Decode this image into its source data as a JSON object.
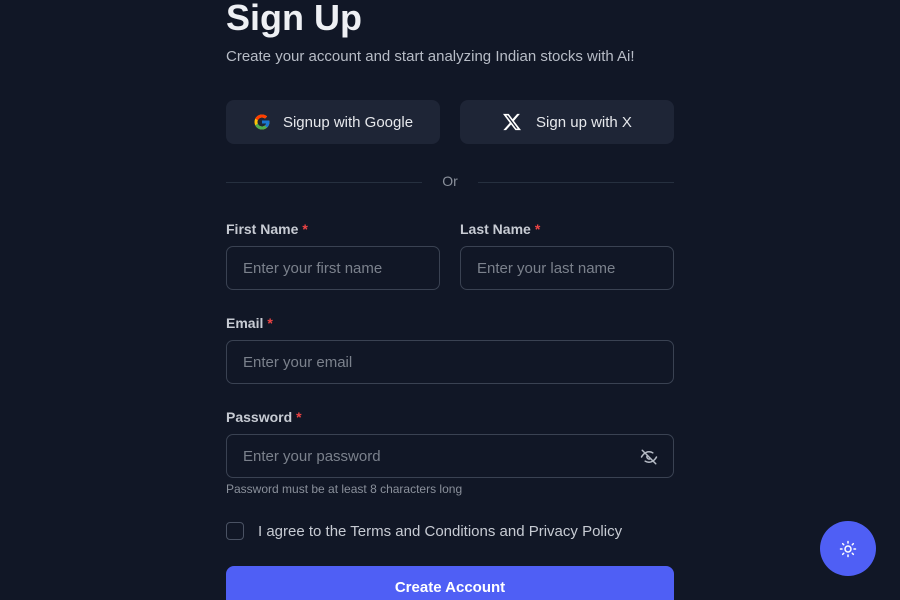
{
  "header": {
    "title": "Sign Up",
    "subtitle": "Create your account and start analyzing Indian stocks with Ai!"
  },
  "oauth": {
    "google_label": "Signup with Google",
    "google_icon": "google-icon",
    "x_label": "Sign up with X",
    "x_icon": "x-logo-icon"
  },
  "divider": {
    "text": "Or"
  },
  "fields": {
    "first_name": {
      "label": "First Name",
      "required_mark": "*",
      "placeholder": "Enter your first name",
      "value": ""
    },
    "last_name": {
      "label": "Last Name",
      "required_mark": "*",
      "placeholder": "Enter your last name",
      "value": ""
    },
    "email": {
      "label": "Email",
      "required_mark": "*",
      "placeholder": "Enter your email",
      "value": ""
    },
    "password": {
      "label": "Password",
      "required_mark": "*",
      "placeholder": "Enter your password",
      "value": "",
      "hint": "Password must be at least 8 characters long",
      "toggle_icon": "eye-off-icon"
    }
  },
  "agreement": {
    "label": "I agree to the Terms and Conditions and Privacy Policy",
    "checked": false
  },
  "submit": {
    "label": "Create Account"
  },
  "theme_toggle": {
    "icon": "sun-icon"
  },
  "colors": {
    "background": "#111726",
    "accent": "#4f5ff5",
    "required": "#ef4444",
    "input_border": "#3a4252",
    "button_surface": "#1e2536"
  }
}
